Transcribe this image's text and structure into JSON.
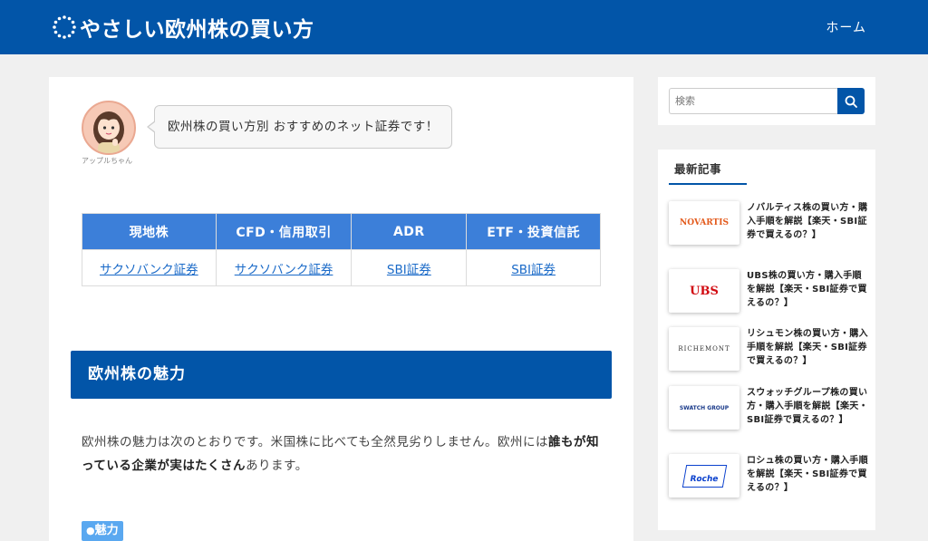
{
  "header": {
    "site_title": "やさしい欧州株の買い方",
    "nav_home": "ホーム"
  },
  "speech": {
    "avatar_name": "アップルちゃん",
    "bubble_text": "欧州株の買い方別 おすすめのネット証券です！"
  },
  "broker_table": {
    "headers": [
      "現地株",
      "CFD・信用取引",
      "ADR",
      "ETF・投資信託"
    ],
    "links": [
      "サクソバンク証券",
      "サクソバンク証券",
      "SBI証券",
      "SBI証券"
    ]
  },
  "section": {
    "heading": "欧州株の魅力",
    "para_plain_1": "欧州株の魅力は次のとおりです。米国株に比べても全然見劣りしません。欧州には",
    "para_bold": "誰もが知っている企業が実はたくさん",
    "para_plain_2": "あります。",
    "tag_label": "魅力"
  },
  "sidebar": {
    "search_placeholder": "検索",
    "recent_title": "最新記事",
    "recent": [
      {
        "brand": "NOVARTIS",
        "brand_color": "#e35a1c",
        "title": "ノバルティス株の買い方・購入手順を解説【楽天・SBI証券で買えるの？】"
      },
      {
        "brand": "UBS",
        "brand_color": "#d10a11",
        "title": "UBS株の買い方・購入手順を解説【楽天・SBI証券で買えるの？】"
      },
      {
        "brand": "RICHEMONT",
        "brand_color": "#333333",
        "title": "リシュモン株の買い方・購入手順を解説【楽天・SBI証券で買えるの？】"
      },
      {
        "brand": "SWATCH GROUP",
        "brand_color": "#1a3a8a",
        "title": "スウォッチグループ株の買い方・購入手順を解説【楽天・SBI証券で買えるの？】"
      },
      {
        "brand": "Roche",
        "brand_color": "#0b41cd",
        "title": "ロシュ株の買い方・購入手順を解説【楽天・SBI証券で買えるの？】"
      }
    ]
  },
  "colors": {
    "brand_blue": "#0255a8",
    "table_header_blue": "#3c7fd9",
    "link_blue": "#1a6ac8"
  }
}
